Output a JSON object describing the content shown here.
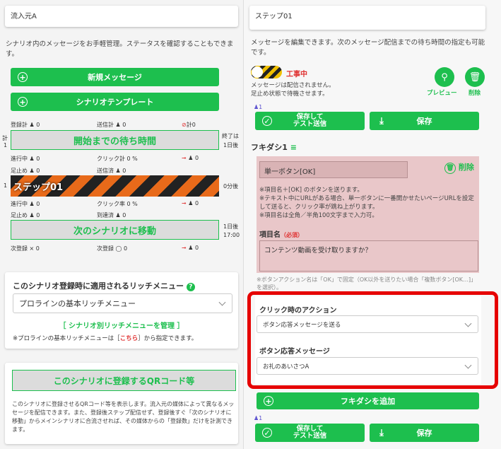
{
  "left": {
    "source_title": "流入元A",
    "description": "シナリオ内のメッセージをお手軽管理。ステータスを確認することもできます。",
    "new_message_btn": "新規メッセージ",
    "template_btn": "シナリオテンプレート",
    "stats_top": {
      "registered": "登録計",
      "registered_val": "0",
      "sent": "送信計",
      "sent_val": "0",
      "blocked_val": "計0"
    },
    "side_total": "計",
    "side_one": "1",
    "wait_bar": "開始までの待ち時間",
    "end_label": "終了は",
    "end_val": "1日後",
    "stats_mid1": {
      "active": "進行中",
      "active_val": "0",
      "click_rate": "クリック計",
      "click_val": "0 %",
      "out_val": "0"
    },
    "stats_mid2": {
      "stopped": "足止め",
      "stopped_val": "0",
      "delivered": "送信済",
      "delivered_val": "0"
    },
    "step_name": "ステップ01",
    "step_one": "1",
    "step_after": "0分後",
    "stats_low1": {
      "active": "進行中",
      "active_val": "0",
      "click_rate": "クリック率",
      "click_val": "0 %",
      "out_val": "0"
    },
    "stats_low2": {
      "stopped": "足止め",
      "stopped_val": "0",
      "reached": "到達済",
      "reached_val": "0"
    },
    "next_bar": "次のシナリオに移動",
    "next_day": "1日後",
    "next_time": "17:00",
    "stats_bottom": {
      "next_reg": "次登録",
      "next_reg_val": "× 0",
      "next_reg2": "次登録",
      "next_reg2_val": "◯ 0",
      "out_val": "0"
    },
    "rich_title": "このシナリオ登録時に適用されるリッチメニュー",
    "rich_select": "プロラインの基本リッチメニュー",
    "rich_link": "［ シナリオ別リッチメニューを管理 ］",
    "rich_note_a": "※プロラインの基本リッチメニューは［",
    "rich_note_link": "こちら",
    "rich_note_b": "］から指定できます。",
    "qr_btn": "このシナリオに登録するQRコード等",
    "qr_text": "このシナリオに登録させるQRコード等を表示します。流入元の媒体によって異なるメッセージを配信できます。また、登録後ステップ配信せず、登録後すぐ「次のシナリオに移動」からメインシナリオに合流させれば、その媒体からの「登録数」だけを計測できます。"
  },
  "right": {
    "step_title": "ステップ01",
    "description": "メッセージを編集できます。次のメッセージ配信までの待ち時間の指定も可能です。",
    "status_label": "工事中",
    "status_note1": "メッセージは配信されません。",
    "status_note2": "足止め状態で待機させます。",
    "preview_label": "プレビュー",
    "delete_label": "削除",
    "count": "1",
    "save_test": "保存して\nテスト送信",
    "save": "保存",
    "fukidashi_label": "フキダシ1",
    "button_type": "単一ボタン[OK]",
    "bubble_delete": "削除",
    "bubble_note": "※項目名＋[OK] のボタンを送ります。\n※テキスト中にURLがある場合、単一ボタンに一番開かせたいページURLを設定して送ると、クリック率が跳ね上がります。\n※項目名は全角／半角100文字まで入力可。",
    "item_name_label": "項目名",
    "required": "（必須）",
    "item_value": "コンテンツ動画を受け取りますか？",
    "btn_action_note": "※ボタンアクション名は「OK」で固定（OK以外を送りたい場合「複数ボタン[OK…]」を選択）。",
    "click_action_label": "クリック時のアクション",
    "click_action_value": "ボタン応答メッセージを送る",
    "reply_label": "ボタン応答メッセージ",
    "reply_value": "お礼のあいさつA",
    "add_bubble": "フキダシを追加",
    "count2": "1",
    "save_test2": "保存して\nテスト送信",
    "save2": "保存"
  },
  "colors": {
    "green": "#1dbf4e",
    "red": "#e03131",
    "pink": "#e9c7c9",
    "orange": "#e86a1a"
  }
}
